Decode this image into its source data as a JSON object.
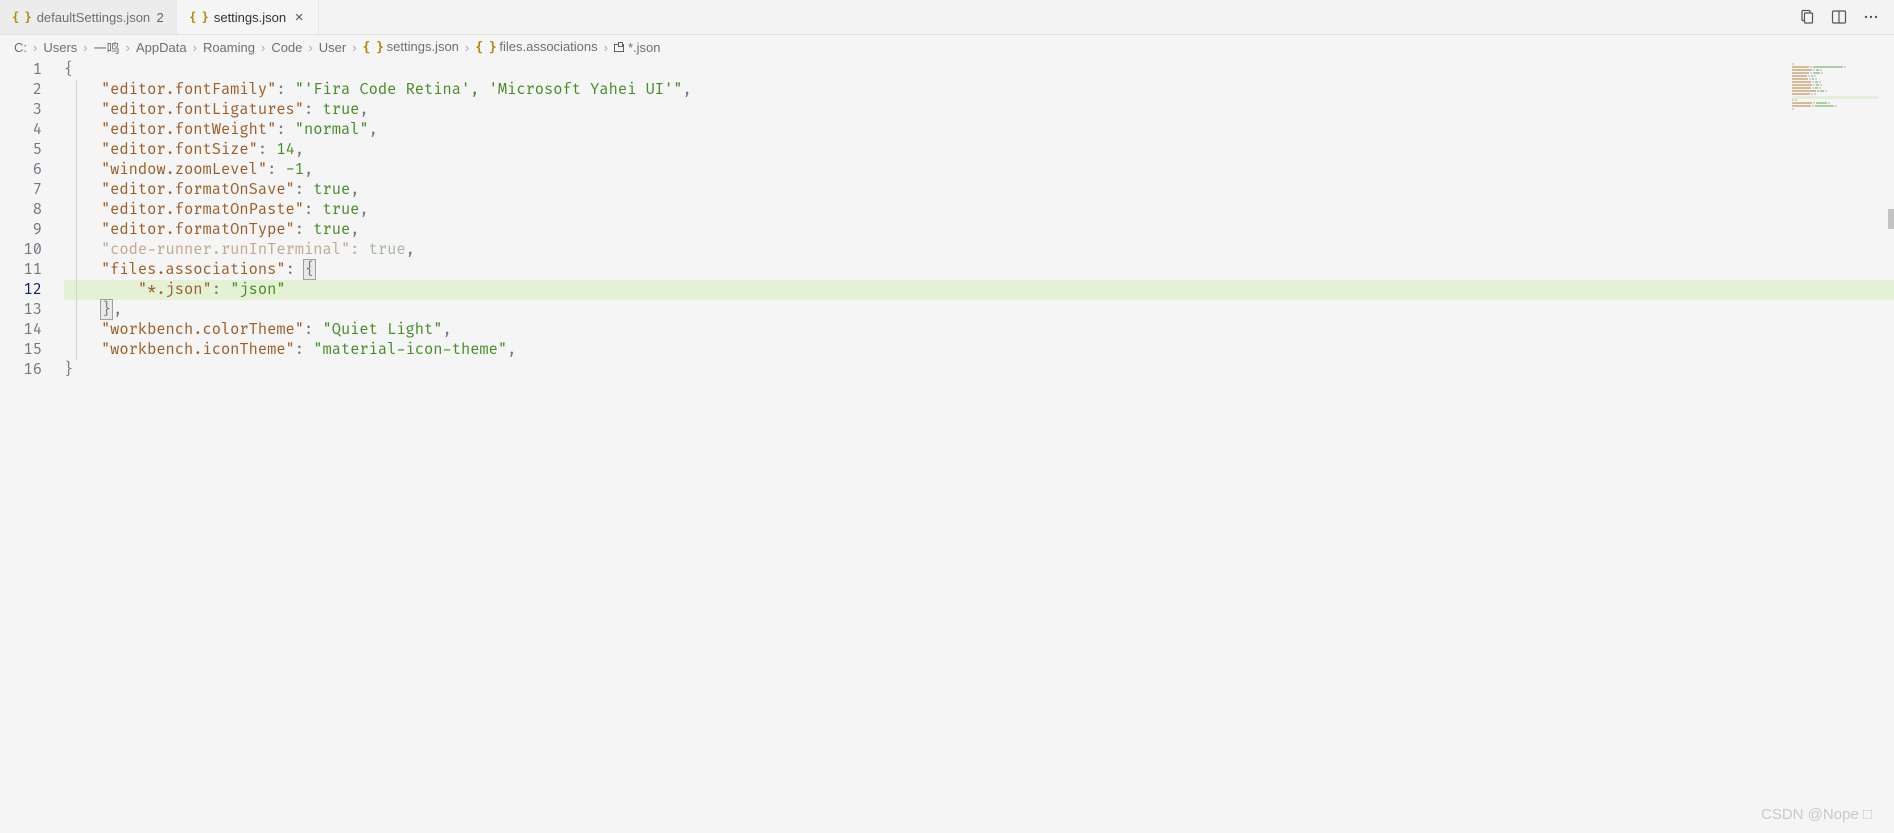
{
  "tabs": [
    {
      "label": "defaultSettings.json",
      "modified_count": "2",
      "active": false
    },
    {
      "label": "settings.json",
      "active": true
    }
  ],
  "breadcrumbs": [
    {
      "text": "C:"
    },
    {
      "text": "Users"
    },
    {
      "text": "一鸣"
    },
    {
      "text": "AppData"
    },
    {
      "text": "Roaming"
    },
    {
      "text": "Code"
    },
    {
      "text": "User"
    },
    {
      "icon": "json",
      "text": "settings.json"
    },
    {
      "icon": "json",
      "text": "files.associations"
    },
    {
      "icon": "abc",
      "text": "*.json"
    }
  ],
  "code": {
    "active_line": 12,
    "lines": [
      {
        "n": 1,
        "indent": 0,
        "tokens": [
          {
            "t": "{",
            "c": "punc"
          }
        ]
      },
      {
        "n": 2,
        "indent": 1,
        "tokens": [
          {
            "t": "\"editor.fontFamily\"",
            "c": "key"
          },
          {
            "t": ": ",
            "c": "punc"
          },
          {
            "t": "\"'Fira Code Retina', 'Microsoft Yahei UI'\"",
            "c": "str"
          },
          {
            "t": ",",
            "c": "punc"
          }
        ]
      },
      {
        "n": 3,
        "indent": 1,
        "tokens": [
          {
            "t": "\"editor.fontLigatures\"",
            "c": "key"
          },
          {
            "t": ": ",
            "c": "punc"
          },
          {
            "t": "true",
            "c": "bool"
          },
          {
            "t": ",",
            "c": "punc"
          }
        ]
      },
      {
        "n": 4,
        "indent": 1,
        "tokens": [
          {
            "t": "\"editor.fontWeight\"",
            "c": "key"
          },
          {
            "t": ": ",
            "c": "punc"
          },
          {
            "t": "\"normal\"",
            "c": "str"
          },
          {
            "t": ",",
            "c": "punc"
          }
        ]
      },
      {
        "n": 5,
        "indent": 1,
        "tokens": [
          {
            "t": "\"editor.fontSize\"",
            "c": "key"
          },
          {
            "t": ": ",
            "c": "punc"
          },
          {
            "t": "14",
            "c": "num"
          },
          {
            "t": ",",
            "c": "punc"
          }
        ]
      },
      {
        "n": 6,
        "indent": 1,
        "tokens": [
          {
            "t": "\"window.zoomLevel\"",
            "c": "key"
          },
          {
            "t": ": ",
            "c": "punc"
          },
          {
            "t": "-1",
            "c": "num"
          },
          {
            "t": ",",
            "c": "punc"
          }
        ]
      },
      {
        "n": 7,
        "indent": 1,
        "tokens": [
          {
            "t": "\"editor.formatOnSave\"",
            "c": "key"
          },
          {
            "t": ": ",
            "c": "punc"
          },
          {
            "t": "true",
            "c": "bool"
          },
          {
            "t": ",",
            "c": "punc"
          }
        ]
      },
      {
        "n": 8,
        "indent": 1,
        "tokens": [
          {
            "t": "\"editor.formatOnPaste\"",
            "c": "key"
          },
          {
            "t": ": ",
            "c": "punc"
          },
          {
            "t": "true",
            "c": "bool"
          },
          {
            "t": ",",
            "c": "punc"
          }
        ]
      },
      {
        "n": 9,
        "indent": 1,
        "tokens": [
          {
            "t": "\"editor.formatOnType\"",
            "c": "key"
          },
          {
            "t": ": ",
            "c": "punc"
          },
          {
            "t": "true",
            "c": "bool"
          },
          {
            "t": ",",
            "c": "punc"
          }
        ]
      },
      {
        "n": 10,
        "indent": 1,
        "tokens": [
          {
            "t": "\"code-runner.runInTerminal\"",
            "c": "dim"
          },
          {
            "t": ": ",
            "c": "dim"
          },
          {
            "t": "true",
            "c": "dim-bool"
          },
          {
            "t": ",",
            "c": "punc"
          }
        ]
      },
      {
        "n": 11,
        "indent": 1,
        "tokens": [
          {
            "t": "\"files.associations\"",
            "c": "key"
          },
          {
            "t": ": ",
            "c": "punc"
          },
          {
            "t": "{",
            "c": "punc",
            "boxed": true
          }
        ],
        "hlbox": true
      },
      {
        "n": 12,
        "indent": 2,
        "tokens": [
          {
            "t": "\"*.json\"",
            "c": "key"
          },
          {
            "t": ": ",
            "c": "punc"
          },
          {
            "t": "\"json\"",
            "c": "str"
          }
        ],
        "hl": true
      },
      {
        "n": 13,
        "indent": 1,
        "tokens": [
          {
            "t": "}",
            "c": "punc",
            "boxed": true
          },
          {
            "t": ",",
            "c": "punc"
          }
        ],
        "hlbox": true
      },
      {
        "n": 14,
        "indent": 1,
        "tokens": [
          {
            "t": "\"workbench.colorTheme\"",
            "c": "key"
          },
          {
            "t": ": ",
            "c": "punc"
          },
          {
            "t": "\"Quiet Light\"",
            "c": "str"
          },
          {
            "t": ",",
            "c": "punc"
          }
        ]
      },
      {
        "n": 15,
        "indent": 1,
        "tokens": [
          {
            "t": "\"workbench.iconTheme\"",
            "c": "key"
          },
          {
            "t": ": ",
            "c": "punc"
          },
          {
            "t": "\"material-icon-theme\"",
            "c": "str"
          },
          {
            "t": ",",
            "c": "punc"
          }
        ]
      },
      {
        "n": 16,
        "indent": 0,
        "tokens": [
          {
            "t": "}",
            "c": "punc"
          }
        ]
      }
    ]
  },
  "watermark": "CSDN @Nope □"
}
